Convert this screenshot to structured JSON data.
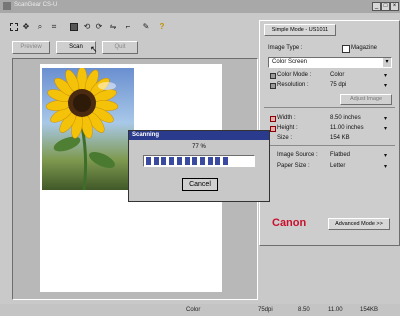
{
  "window": {
    "title": "ScanGear CS-U",
    "min": "_",
    "max": "□",
    "close": "×"
  },
  "toolbar": {
    "icons": [
      "marquee-icon",
      "move-icon",
      "zoom-icon",
      "crop-icon",
      "auto-tone-icon",
      "rotate-left-icon",
      "rotate-right-icon",
      "mirror-icon",
      "tool-icon",
      "eyedropper-icon",
      "help-icon"
    ]
  },
  "scan_buttons": {
    "preview": "Preview",
    "scan": "Scan",
    "quit": "Quit"
  },
  "panel": {
    "tab": "Simple Mode - US1011",
    "image_type_label": "Image Type :",
    "magazine_label": "Magazine",
    "image_type_value": "Color Screen",
    "color_mode_label": "Color Mode :",
    "color_mode_value": "Color",
    "resolution_label": "Resolution :",
    "resolution_value": "75 dpi",
    "adjust_button": "Adjust Image",
    "width_label": "Width :",
    "width_value": "8.50 inches",
    "height_label": "Height :",
    "height_value": "11.00 inches",
    "size_label": "Size :",
    "size_value": "154 KB",
    "image_source_label": "Image Source :",
    "image_source_value": "Flatbed",
    "paper_size_label": "Paper Size :",
    "paper_size_value": "Letter",
    "brand": "Canon",
    "advanced_button": "Advanced Mode >>"
  },
  "dialog": {
    "title": "Scanning",
    "percent": "77 %",
    "progress": 0.77,
    "cancel": "Cancel"
  },
  "status": {
    "mode": "Color",
    "dpi": "75dpi",
    "w": "8.50",
    "h": "11.00",
    "size": "154KB"
  },
  "colors": {
    "brand": "#c8102e",
    "dialog_title_bg": "#2a3a8c",
    "progress": "#3a4aa0"
  }
}
